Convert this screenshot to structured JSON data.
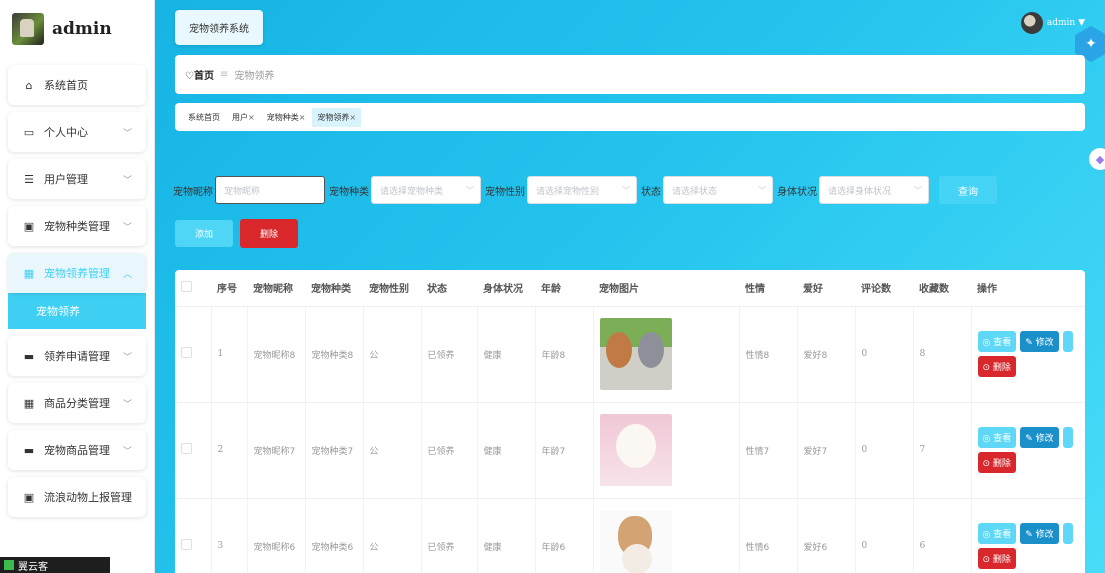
{
  "brand": {
    "title": "admin"
  },
  "sidebar": {
    "items": [
      {
        "label": "系统首页",
        "icon": "⌂",
        "arrow": ""
      },
      {
        "label": "个人中心",
        "icon": "▭",
        "arrow": "﹀"
      },
      {
        "label": "用户管理",
        "icon": "☰",
        "arrow": "﹀"
      },
      {
        "label": "宠物种类管理",
        "icon": "▣",
        "arrow": "﹀"
      },
      {
        "label": "宠物领养管理",
        "icon": "▦",
        "arrow": "︿"
      },
      {
        "label": "领养申请管理",
        "icon": "▬",
        "arrow": "﹀"
      },
      {
        "label": "商品分类管理",
        "icon": "▦",
        "arrow": "﹀"
      },
      {
        "label": "宠物商品管理",
        "icon": "▬",
        "arrow": "﹀"
      },
      {
        "label": "流浪动物上报管理",
        "icon": "▣",
        "arrow": ""
      }
    ],
    "submenu": "宠物领养",
    "taskbar": "翼云客"
  },
  "header": {
    "system_tag": "宠物领养系统",
    "username": "admin ▼"
  },
  "breadcrumb": {
    "home": "♡首页",
    "sep": "≡",
    "current": "宠物领养"
  },
  "tabs": [
    {
      "label": "系统首页",
      "close": ""
    },
    {
      "label": "用户",
      "close": "×"
    },
    {
      "label": "宠物种类",
      "close": "×"
    },
    {
      "label": "宠物领养",
      "close": "×"
    }
  ],
  "search": {
    "nickname_label": "宠物昵称",
    "nickname_placeholder": "宠物昵称",
    "type_label": "宠物种类",
    "type_placeholder": "请选择宠物种类",
    "gender_label": "宠物性别",
    "gender_placeholder": "请选择宠物性别",
    "status_label": "状态",
    "status_placeholder": "请选择状态",
    "health_label": "身体状况",
    "health_placeholder": "请选择身体状况",
    "query_label": "查询"
  },
  "actions": {
    "add_label": "添加",
    "delete_label": "删除"
  },
  "table": {
    "columns": [
      "序号",
      "宠物昵称",
      "宠物种类",
      "宠物性别",
      "状态",
      "身体状况",
      "年龄",
      "宠物图片",
      "性情",
      "爱好",
      "评论数",
      "收藏数",
      "操作"
    ],
    "rows": [
      {
        "no": "1",
        "nickname": "宠物昵称8",
        "type": "宠物种类8",
        "gender": "公",
        "status": "已领养",
        "health": "健康",
        "age": "年龄8",
        "temper": "性情8",
        "hobby": "爱好8",
        "comments": "0",
        "favorites": "8"
      },
      {
        "no": "2",
        "nickname": "宠物昵称7",
        "type": "宠物种类7",
        "gender": "公",
        "status": "已领养",
        "health": "健康",
        "age": "年龄7",
        "temper": "性情7",
        "hobby": "爱好7",
        "comments": "0",
        "favorites": "7"
      },
      {
        "no": "3",
        "nickname": "宠物昵称6",
        "type": "宠物种类6",
        "gender": "公",
        "status": "已领养",
        "health": "健康",
        "age": "年龄6",
        "temper": "性情6",
        "hobby": "爱好6",
        "comments": "0",
        "favorites": "6"
      }
    ],
    "op_view": "◎ 查看",
    "op_edit": "✎ 修改",
    "op_delete": "⊙ 删除"
  },
  "colors": {
    "accent": "#3fcff3",
    "danger": "#d9282c",
    "edit": "#1a8fc9"
  }
}
